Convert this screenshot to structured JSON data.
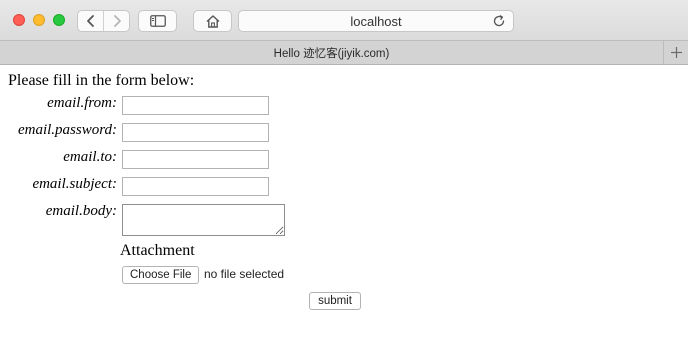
{
  "browser": {
    "address": "localhost",
    "tab_title": "Hello 迹忆客(jiyik.com)",
    "new_tab_symbol": "+"
  },
  "form": {
    "intro": "Please fill in the form below:",
    "fields": [
      {
        "label": "email.from:",
        "value": ""
      },
      {
        "label": "email.password:",
        "value": ""
      },
      {
        "label": "email.to:",
        "value": ""
      },
      {
        "label": "email.subject:",
        "value": ""
      }
    ],
    "body_label": "email.body:",
    "body_value": "",
    "attachment_label": "Attachment",
    "choose_file_label": "Choose File",
    "file_status": "no file selected",
    "submit_label": "submit"
  }
}
